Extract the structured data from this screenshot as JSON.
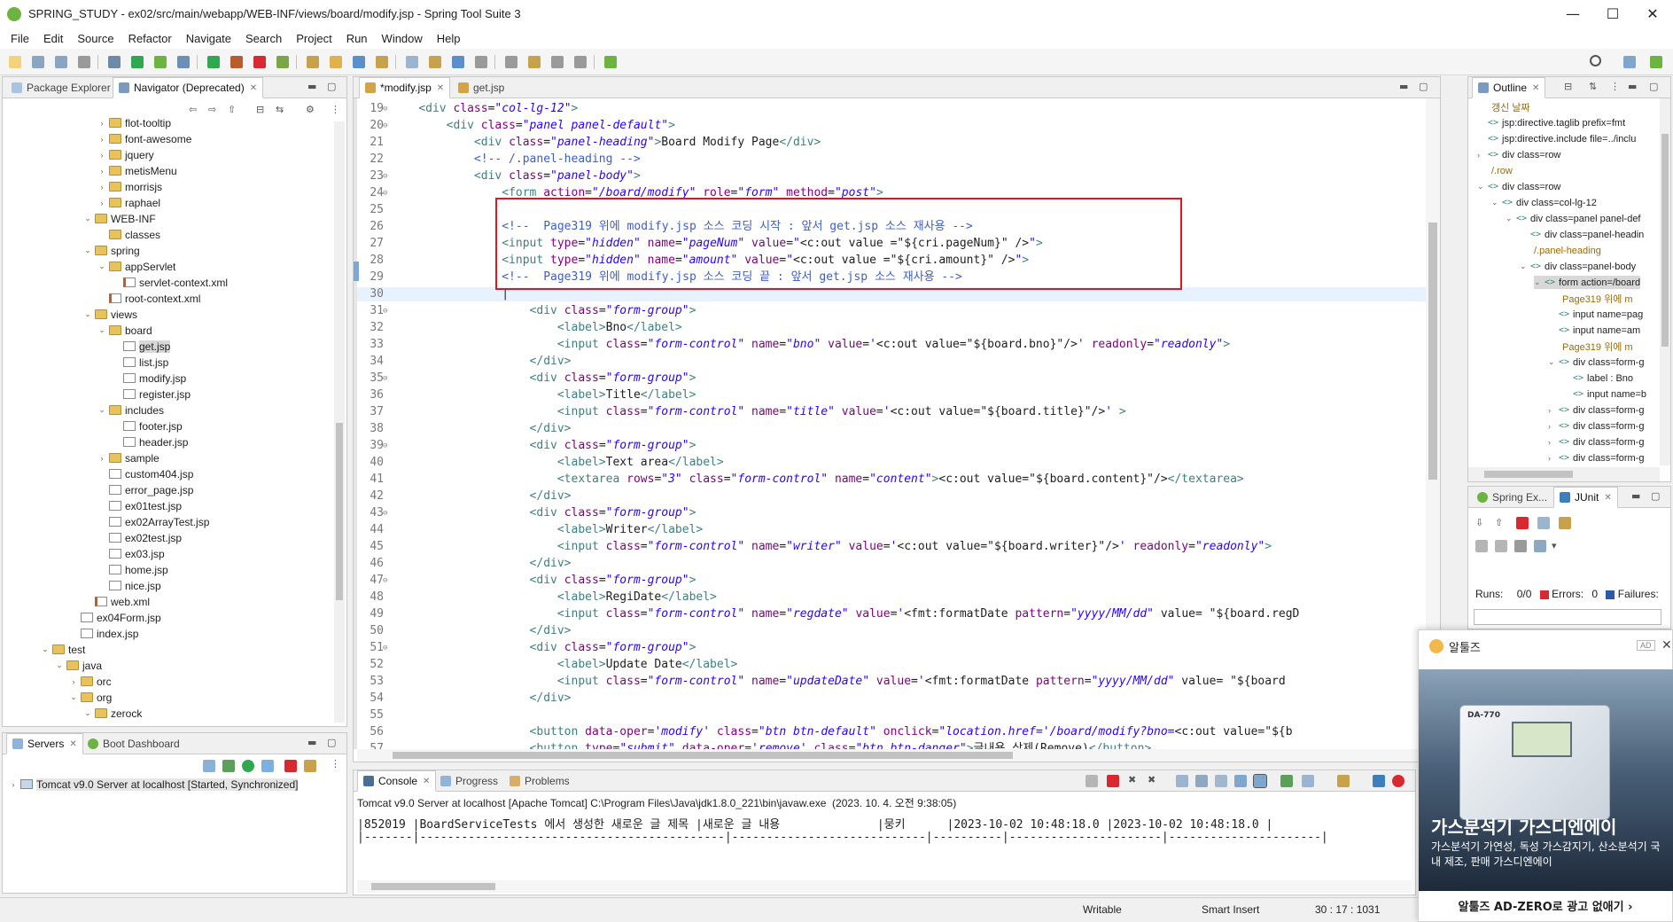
{
  "window": {
    "title": "SPRING_STUDY - ex02/src/main/webapp/WEB-INF/views/board/modify.jsp - Spring Tool Suite 3",
    "minimize": "—",
    "maximize": "☐",
    "close": "✕"
  },
  "menu": [
    "File",
    "Edit",
    "Source",
    "Refactor",
    "Navigate",
    "Search",
    "Project",
    "Run",
    "Window",
    "Help"
  ],
  "left_panel": {
    "tabs": [
      "Package Explorer",
      "Navigator (Deprecated)"
    ],
    "tree": [
      {
        "label": "flot-tooltip",
        "type": "folder",
        "arrow": "›"
      },
      {
        "label": "font-awesome",
        "type": "folder",
        "arrow": "›"
      },
      {
        "label": "jquery",
        "type": "folder",
        "arrow": "›"
      },
      {
        "label": "metisMenu",
        "type": "folder",
        "arrow": "›"
      },
      {
        "label": "morrisjs",
        "type": "folder",
        "arrow": "›"
      },
      {
        "label": "raphael",
        "type": "folder",
        "arrow": "›"
      },
      {
        "label": "WEB-INF",
        "type": "folder",
        "arrow": "⌄"
      },
      {
        "label": "classes",
        "type": "folder",
        "arrow": ""
      },
      {
        "label": "spring",
        "type": "folder",
        "arrow": "⌄"
      },
      {
        "label": "appServlet",
        "type": "folder",
        "arrow": "⌄"
      },
      {
        "label": "servlet-context.xml",
        "type": "xml",
        "arrow": ""
      },
      {
        "label": "root-context.xml",
        "type": "xml",
        "arrow": ""
      },
      {
        "label": "views",
        "type": "folder",
        "arrow": "⌄"
      },
      {
        "label": "board",
        "type": "folder",
        "arrow": "⌄"
      },
      {
        "label": "get.jsp",
        "type": "file",
        "arrow": "",
        "selected": true
      },
      {
        "label": "list.jsp",
        "type": "file",
        "arrow": ""
      },
      {
        "label": "modify.jsp",
        "type": "file",
        "arrow": ""
      },
      {
        "label": "register.jsp",
        "type": "file",
        "arrow": ""
      },
      {
        "label": "includes",
        "type": "folder",
        "arrow": "⌄"
      },
      {
        "label": "footer.jsp",
        "type": "file",
        "arrow": ""
      },
      {
        "label": "header.jsp",
        "type": "file",
        "arrow": ""
      },
      {
        "label": "sample",
        "type": "folder",
        "arrow": "›"
      },
      {
        "label": "custom404.jsp",
        "type": "file",
        "arrow": ""
      },
      {
        "label": "error_page.jsp",
        "type": "file",
        "arrow": ""
      },
      {
        "label": "ex01test.jsp",
        "type": "file",
        "arrow": ""
      },
      {
        "label": "ex02ArrayTest.jsp",
        "type": "file",
        "arrow": ""
      },
      {
        "label": "ex02test.jsp",
        "type": "file",
        "arrow": ""
      },
      {
        "label": "ex03.jsp",
        "type": "file",
        "arrow": ""
      },
      {
        "label": "home.jsp",
        "type": "file",
        "arrow": ""
      },
      {
        "label": "nice.jsp",
        "type": "file",
        "arrow": ""
      },
      {
        "label": "web.xml",
        "type": "xml",
        "arrow": ""
      },
      {
        "label": "ex04Form.jsp",
        "type": "file",
        "arrow": ""
      },
      {
        "label": "index.jsp",
        "type": "file",
        "arrow": ""
      },
      {
        "label": "test",
        "type": "folder",
        "arrow": "⌄"
      },
      {
        "label": "java",
        "type": "folder",
        "arrow": "⌄"
      },
      {
        "label": "orc",
        "type": "folder",
        "arrow": "›"
      },
      {
        "label": "org",
        "type": "folder",
        "arrow": "⌄"
      },
      {
        "label": "zerock",
        "type": "folder",
        "arrow": "⌄"
      }
    ]
  },
  "servers_panel": {
    "tabs": [
      "Servers",
      "Boot Dashboard"
    ],
    "server": "Tomcat v9.0 Server at localhost  [Started, Synchronized]"
  },
  "editor": {
    "tabs": [
      "*modify.jsp",
      "get.jsp"
    ],
    "lines": [
      {
        "n": "19",
        "fold": "⊖",
        "html": "    <span class=\"tg\">&lt;div</span> <span class=\"at\">class</span>=<span class=\"vl\">\"col-lg-12\"</span><span class=\"tg\">&gt;</span>"
      },
      {
        "n": "20",
        "fold": "⊖",
        "html": "        <span class=\"tg\">&lt;div</span> <span class=\"at\">class</span>=<span class=\"vl\">\"panel panel-default\"</span><span class=\"tg\">&gt;</span>"
      },
      {
        "n": "21",
        "fold": "",
        "html": "            <span class=\"tg\">&lt;div</span> <span class=\"at\">class</span>=<span class=\"vl\">\"panel-heading\"</span><span class=\"tg\">&gt;</span>Board Modify Page<span class=\"tg\">&lt;/div&gt;</span>"
      },
      {
        "n": "22",
        "fold": "",
        "html": "            <span class=\"cm\">&lt;!-- /.panel-heading --&gt;</span>"
      },
      {
        "n": "23",
        "fold": "⊖",
        "html": "            <span class=\"tg\">&lt;div</span> <span class=\"at\">class</span>=<span class=\"vl\">\"panel-body\"</span><span class=\"tg\">&gt;</span>"
      },
      {
        "n": "24",
        "fold": "⊖",
        "html": "                <span class=\"tg\">&lt;form</span> <span class=\"at\">action</span>=<span class=\"vl\">\"/board/modify\"</span> <span class=\"at\">role</span>=<span class=\"vl\">\"form\"</span> <span class=\"at\">method</span>=<span class=\"vl\">\"post\"</span><span class=\"tg\">&gt;</span>"
      },
      {
        "n": "25",
        "fold": "",
        "html": ""
      },
      {
        "n": "26",
        "fold": "",
        "html": "                <span class=\"cm\">&lt;!--  Page319 위에 modify.jsp 소스 코딩 시작 : 앞서 get.jsp 소스 재사용 --&gt;</span>"
      },
      {
        "n": "27",
        "fold": "",
        "html": "                <span class=\"tg\">&lt;input</span> <span class=\"at\">type</span>=<span class=\"vl\">\"hidden\"</span> <span class=\"at\">name</span>=<span class=\"vl\">\"pageNum\"</span> <span class=\"at\">value</span>=<span class=\"vl\">\"</span>&lt;c:out value =\"${cri.pageNum}\" /&gt;<span class=\"vl\">\"</span><span class=\"tg\">&gt;</span>"
      },
      {
        "n": "28",
        "fold": "",
        "html": "                <span class=\"tg\">&lt;input</span> <span class=\"at\">type</span>=<span class=\"vl\">\"hidden\"</span> <span class=\"at\">name</span>=<span class=\"vl\">\"amount\"</span> <span class=\"at\">value</span>=<span class=\"vl\">\"</span>&lt;c:out value =\"${cri.amount}\" /&gt;<span class=\"vl\">\"</span><span class=\"tg\">&gt;</span>"
      },
      {
        "n": "29",
        "fold": "",
        "html": "                <span class=\"cm\">&lt;!--  Page319 위에 modify.jsp 소스 코딩 끝 : 앞서 get.jsp 소스 재사용 --&gt;</span>"
      },
      {
        "n": "30",
        "fold": "",
        "html": "                |"
      },
      {
        "n": "31",
        "fold": "⊖",
        "html": "                    <span class=\"tg\">&lt;div</span> <span class=\"at\">class</span>=<span class=\"vl\">\"form-group\"</span><span class=\"tg\">&gt;</span>"
      },
      {
        "n": "32",
        "fold": "",
        "html": "                        <span class=\"tg\">&lt;label&gt;</span>Bno<span class=\"tg\">&lt;/label&gt;</span>"
      },
      {
        "n": "33",
        "fold": "",
        "html": "                        <span class=\"tg\">&lt;input</span> <span class=\"at\">class</span>=<span class=\"vl\">\"form-control\"</span> <span class=\"at\">name</span>=<span class=\"vl\">\"bno\"</span> <span class=\"at\">value</span>=<span class=\"vl\">'</span>&lt;c:out value=\"${board.bno}\"/&gt;<span class=\"vl\">'</span> <span class=\"at\">readonly</span>=<span class=\"vl\">\"readonly\"</span><span class=\"tg\">&gt;</span>"
      },
      {
        "n": "34",
        "fold": "",
        "html": "                    <span class=\"tg\">&lt;/div&gt;</span>"
      },
      {
        "n": "35",
        "fold": "⊖",
        "html": "                    <span class=\"tg\">&lt;div</span> <span class=\"at\">class</span>=<span class=\"vl\">\"form-group\"</span><span class=\"tg\">&gt;</span>"
      },
      {
        "n": "36",
        "fold": "",
        "html": "                        <span class=\"tg\">&lt;label&gt;</span>Title<span class=\"tg\">&lt;/label&gt;</span>"
      },
      {
        "n": "37",
        "fold": "",
        "html": "                        <span class=\"tg\">&lt;input</span> <span class=\"at\">class</span>=<span class=\"vl\">\"form-control\"</span> <span class=\"at\">name</span>=<span class=\"vl\">\"title\"</span> <span class=\"at\">value</span>=<span class=\"vl\">'</span>&lt;c:out value=\"${board.title}\"/&gt;<span class=\"vl\">'</span> <span class=\"tg\">&gt;</span>"
      },
      {
        "n": "38",
        "fold": "",
        "html": "                    <span class=\"tg\">&lt;/div&gt;</span>"
      },
      {
        "n": "39",
        "fold": "⊖",
        "html": "                    <span class=\"tg\">&lt;div</span> <span class=\"at\">class</span>=<span class=\"vl\">\"form-group\"</span><span class=\"tg\">&gt;</span>"
      },
      {
        "n": "40",
        "fold": "",
        "html": "                        <span class=\"tg\">&lt;label&gt;</span>Text area<span class=\"tg\">&lt;/label&gt;</span>"
      },
      {
        "n": "41",
        "fold": "",
        "html": "                        <span class=\"tg\">&lt;textarea</span> <span class=\"at\">rows</span>=<span class=\"vl\">\"3\"</span> <span class=\"at\">class</span>=<span class=\"vl\">\"form-control\"</span> <span class=\"at\">name</span>=<span class=\"vl\">\"content\"</span><span class=\"tg\">&gt;</span>&lt;c:out value=\"${board.content}\"/&gt;<span class=\"tg\">&lt;/textarea&gt;</span>"
      },
      {
        "n": "42",
        "fold": "",
        "html": "                    <span class=\"tg\">&lt;/div&gt;</span>"
      },
      {
        "n": "43",
        "fold": "⊖",
        "html": "                    <span class=\"tg\">&lt;div</span> <span class=\"at\">class</span>=<span class=\"vl\">\"form-group\"</span><span class=\"tg\">&gt;</span>"
      },
      {
        "n": "44",
        "fold": "",
        "html": "                        <span class=\"tg\">&lt;label&gt;</span>Writer<span class=\"tg\">&lt;/label&gt;</span>"
      },
      {
        "n": "45",
        "fold": "",
        "html": "                        <span class=\"tg\">&lt;input</span> <span class=\"at\">class</span>=<span class=\"vl\">\"form-control\"</span> <span class=\"at\">name</span>=<span class=\"vl\">\"writer\"</span> <span class=\"at\">value</span>=<span class=\"vl\">'</span>&lt;c:out value=\"${board.writer}\"/&gt;<span class=\"vl\">'</span> <span class=\"at\">readonly</span>=<span class=\"vl\">\"readonly\"</span><span class=\"tg\">&gt;</span>"
      },
      {
        "n": "46",
        "fold": "",
        "html": "                    <span class=\"tg\">&lt;/div&gt;</span>"
      },
      {
        "n": "47",
        "fold": "⊖",
        "html": "                    <span class=\"tg\">&lt;div</span> <span class=\"at\">class</span>=<span class=\"vl\">\"form-group\"</span><span class=\"tg\">&gt;</span>"
      },
      {
        "n": "48",
        "fold": "",
        "html": "                        <span class=\"tg\">&lt;label&gt;</span>RegiDate<span class=\"tg\">&lt;/label&gt;</span>"
      },
      {
        "n": "49",
        "fold": "",
        "html": "                        <span class=\"tg\">&lt;input</span> <span class=\"at\">class</span>=<span class=\"vl\">\"form-control\"</span> <span class=\"at\">name</span>=<span class=\"vl\">\"regdate\"</span> <span class=\"at\">value</span>=<span class=\"vl\">'</span>&lt;fmt:formatDate <span class=\"at\">pattern</span>=<span class=\"vl\">\"yyyy/MM/dd\"</span> value= \"${board.regD"
      },
      {
        "n": "50",
        "fold": "",
        "html": "                    <span class=\"tg\">&lt;/div&gt;</span>"
      },
      {
        "n": "51",
        "fold": "⊖",
        "html": "                    <span class=\"tg\">&lt;div</span> <span class=\"at\">class</span>=<span class=\"vl\">\"form-group\"</span><span class=\"tg\">&gt;</span>"
      },
      {
        "n": "52",
        "fold": "",
        "html": "                        <span class=\"tg\">&lt;label&gt;</span>Update Date<span class=\"tg\">&lt;/label&gt;</span>"
      },
      {
        "n": "53",
        "fold": "",
        "html": "                        <span class=\"tg\">&lt;input</span> <span class=\"at\">class</span>=<span class=\"vl\">\"form-control\"</span> <span class=\"at\">name</span>=<span class=\"vl\">\"updateDate\"</span> <span class=\"at\">value</span>=<span class=\"vl\">'</span>&lt;fmt:formatDate <span class=\"at\">pattern</span>=<span class=\"vl\">\"yyyy/MM/dd\"</span> value= \"${board"
      },
      {
        "n": "54",
        "fold": "",
        "html": "                    <span class=\"tg\">&lt;/div&gt;</span>"
      },
      {
        "n": "55",
        "fold": "",
        "html": ""
      },
      {
        "n": "56",
        "fold": "",
        "html": "                    <span class=\"tg\">&lt;button</span> <span class=\"at\">data-oper</span>=<span class=\"vl\">'modify'</span> <span class=\"at\">class</span>=<span class=\"vl\">\"btn btn-default\"</span> <span class=\"at\">onclick</span>=<span class=\"vl\">\"location.href='/board/modify?bno=</span>&lt;c:out value=\"${b"
      },
      {
        "n": "57",
        "fold": "",
        "html": "                    <span class=\"tg\">&lt;button</span> <span class=\"at\">type</span>=<span class=\"vl\">\"submit\"</span> <span class=\"at\">data-oper</span>=<span class=\"vl\">'remove'</span> <span class=\"at\">class</span>=<span class=\"vl\">\"btn btn-danger\"</span><span class=\"tg\">&gt;</span>글내용 삭제(Remove)<span class=\"tg\">&lt;/button&gt;</span>"
      }
    ]
  },
  "outline": {
    "tab": "Outline",
    "rows": [
      {
        "indent": 0,
        "arrow": "",
        "tag": "",
        "text": "갱신 날짜",
        "dim": true
      },
      {
        "indent": 0,
        "arrow": "",
        "tag": "<>",
        "text": "jsp:directive.taglib prefix=fmt"
      },
      {
        "indent": 0,
        "arrow": "",
        "tag": "<>",
        "text": "jsp:directive.include file=../inclu"
      },
      {
        "indent": 0,
        "arrow": "›",
        "tag": "<>",
        "text": "div class=row"
      },
      {
        "indent": 0,
        "arrow": "",
        "tag": "",
        "text": "/.row",
        "dim": true
      },
      {
        "indent": 0,
        "arrow": "⌄",
        "tag": "<>",
        "text": "div class=row"
      },
      {
        "indent": 1,
        "arrow": "⌄",
        "tag": "<>",
        "text": "div class=col-lg-12"
      },
      {
        "indent": 2,
        "arrow": "⌄",
        "tag": "<>",
        "text": "div class=panel panel-def"
      },
      {
        "indent": 3,
        "arrow": "",
        "tag": "<>",
        "text": "div class=panel-headin"
      },
      {
        "indent": 3,
        "arrow": "",
        "tag": "",
        "text": "/.panel-heading",
        "dim": true
      },
      {
        "indent": 3,
        "arrow": "⌄",
        "tag": "<>",
        "text": "div class=panel-body"
      },
      {
        "indent": 4,
        "arrow": "⌄",
        "tag": "<>",
        "text": "form action=/board",
        "selected": true
      },
      {
        "indent": 5,
        "arrow": "",
        "tag": "",
        "text": "Page319 위에 m",
        "dim": true
      },
      {
        "indent": 5,
        "arrow": "",
        "tag": "<>",
        "text": "input name=pag"
      },
      {
        "indent": 5,
        "arrow": "",
        "tag": "<>",
        "text": "input name=am"
      },
      {
        "indent": 5,
        "arrow": "",
        "tag": "",
        "text": "Page319 위에 m",
        "dim": true
      },
      {
        "indent": 5,
        "arrow": "⌄",
        "tag": "<>",
        "text": "div class=form-g"
      },
      {
        "indent": 6,
        "arrow": "",
        "tag": "<>",
        "text": "label : Bno"
      },
      {
        "indent": 6,
        "arrow": "",
        "tag": "<>",
        "text": "input name=b"
      },
      {
        "indent": 5,
        "arrow": "›",
        "tag": "<>",
        "text": "div class=form-g"
      },
      {
        "indent": 5,
        "arrow": "›",
        "tag": "<>",
        "text": "div class=form-g"
      },
      {
        "indent": 5,
        "arrow": "›",
        "tag": "<>",
        "text": "div class=form-g"
      },
      {
        "indent": 5,
        "arrow": "›",
        "tag": "<>",
        "text": "div class=form-g"
      },
      {
        "indent": 5,
        "arrow": "›",
        "tag": "<>",
        "text": "div class=form-g"
      }
    ]
  },
  "junit": {
    "tabs": [
      "Spring Ex...",
      "JUnit"
    ],
    "runs_label": "Runs:",
    "runs_value": "0/0",
    "errors_label": "Errors:",
    "errors_value": "0",
    "failures_label": "Failures:"
  },
  "console": {
    "tabs": [
      "Console",
      "Progress",
      "Problems"
    ],
    "header": "Tomcat v9.0 Server at localhost [Apache Tomcat] C:\\Program Files\\Java\\jdk1.8.0_221\\bin\\javaw.exe  (2023. 10. 4. 오전 9:38:05)",
    "lines": [
      "|852019 |BoardServiceTests 에서 생성한 새로운 글 제목 |새로운 글 내용              |뭉키      |2023-10-02 10:48:18.0 |2023-10-02 10:48:18.0 |",
      "|-------|--------------------------------------------|----------------------------|----------|----------------------|----------------------|"
    ]
  },
  "status": {
    "writable": "Writable",
    "insert_mode": "Smart Insert",
    "position": "30 : 17 : 1031"
  },
  "ad": {
    "brand": "알툴즈",
    "badge": "AD",
    "device_label": "DA-770",
    "headline": "가스분석기 가스디엔에이",
    "body": "가스분석기 가연성, 독성 가스감지기, 산소분석기 국내 제조, 판매 가스디엔에이",
    "footer": "알툴즈 AD-ZERO로 광고 없애기 ›"
  },
  "colors": {
    "highlight_box": "#e4141e",
    "tag": "#3f7f7f",
    "attribute": "#7f007f",
    "value": "#2a00ff",
    "comment": "#3f5fbf"
  }
}
